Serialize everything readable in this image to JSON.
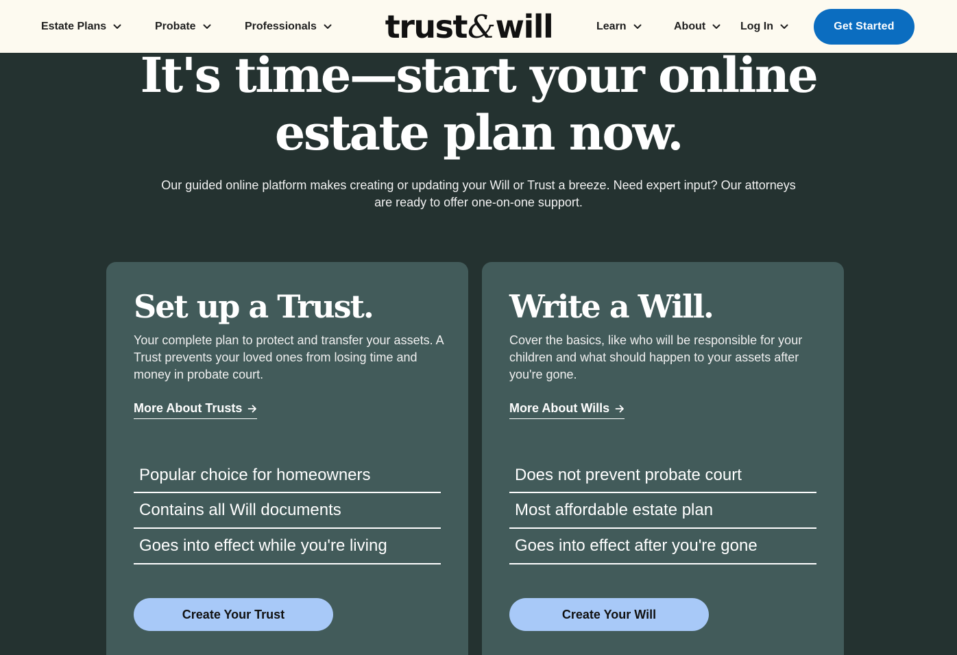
{
  "nav": {
    "left_items": [
      {
        "label": "Estate Plans"
      },
      {
        "label": "Probate"
      },
      {
        "label": "Professionals"
      }
    ],
    "logo": {
      "part1": "trust",
      "amp": "&",
      "part2": "will"
    },
    "right_items": [
      {
        "label": "Learn"
      },
      {
        "label": "About"
      },
      {
        "label": "Log In"
      }
    ],
    "cta_label": "Get Started"
  },
  "hero": {
    "title_line1": "It's time—start your online",
    "title_line2": "estate plan now.",
    "subtitle": "Our guided online platform makes creating or updating your Will or Trust a breeze. Need expert input? Our attorneys are ready to offer one-on-one support."
  },
  "cards": [
    {
      "title": "Set up a Trust.",
      "description": "Your complete plan to protect and transfer your assets. A Trust prevents your loved ones from losing time and money in probate court.",
      "link_label": "More About Trusts",
      "features": [
        "Popular choice for homeowners",
        "Contains all Will documents",
        "Goes into effect while you're living"
      ],
      "button_label": "Create Your Trust"
    },
    {
      "title": "Write a Will.",
      "description": "Cover the basics, like who will be responsible for your children and what should happen to your assets after you're gone.",
      "link_label": "More About Wills",
      "features": [
        "Does not prevent probate court",
        "Most affordable estate plan",
        "Goes into effect after you're gone"
      ],
      "button_label": "Create Your Will"
    }
  ],
  "colors": {
    "nav_bg": "#fdfaf0",
    "page_bg": "#243230",
    "card_bg": "#425b5a",
    "primary_cta": "#0b6dc0",
    "card_button": "#a8c9f8"
  },
  "icons": {
    "nav_dropdown": "chevron-down-icon",
    "link_arrow": "arrow-right-icon"
  }
}
